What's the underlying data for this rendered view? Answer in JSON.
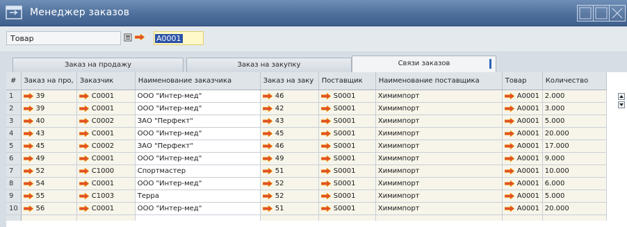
{
  "window": {
    "title": "Менеджер заказов"
  },
  "field": {
    "label": "Товар",
    "value": "A0001"
  },
  "tabs": [
    {
      "label": "Заказ на продажу"
    },
    {
      "label": "Заказ на закупку"
    },
    {
      "label": "Связи заказов"
    }
  ],
  "table": {
    "headers": [
      "#",
      "Заказ на про,",
      "Заказчик",
      "Наименование заказчика",
      "Заказ на заку",
      "Поставщик",
      "Наименование поставщика",
      "Товар",
      "Количество"
    ],
    "rows": [
      {
        "n": "1",
        "sale": "39",
        "cust": "C0001",
        "custName": "ООО \"Интер-мед\"",
        "purch": "46",
        "supp": "S0001",
        "suppName": "Химимпорт",
        "item": "A0001",
        "qty": "2.000"
      },
      {
        "n": "2",
        "sale": "39",
        "cust": "C0001",
        "custName": "ООО \"Интер-мед\"",
        "purch": "42",
        "supp": "S0001",
        "suppName": "Химимпорт",
        "item": "A0001",
        "qty": "3.000"
      },
      {
        "n": "3",
        "sale": "40",
        "cust": "C0002",
        "custName": "ЗАО \"Перфект\"",
        "purch": "43",
        "supp": "S0001",
        "suppName": "Химимпорт",
        "item": "A0001",
        "qty": "5.000"
      },
      {
        "n": "4",
        "sale": "43",
        "cust": "C0001",
        "custName": "ООО \"Интер-мед\"",
        "purch": "45",
        "supp": "S0001",
        "suppName": "Химимпорт",
        "item": "A0001",
        "qty": "20.000"
      },
      {
        "n": "5",
        "sale": "45",
        "cust": "C0002",
        "custName": "ЗАО \"Перфект\"",
        "purch": "46",
        "supp": "S0001",
        "suppName": "Химимпорт",
        "item": "A0001",
        "qty": "17.000"
      },
      {
        "n": "6",
        "sale": "49",
        "cust": "C0001",
        "custName": "ООО \"Интер-мед\"",
        "purch": "49",
        "supp": "S0001",
        "suppName": "Химимпорт",
        "item": "A0001",
        "qty": "9.000"
      },
      {
        "n": "7",
        "sale": "52",
        "cust": "C1000",
        "custName": "Спортмастер",
        "purch": "51",
        "supp": "S0001",
        "suppName": "Химимпорт",
        "item": "A0001",
        "qty": "10.000"
      },
      {
        "n": "8",
        "sale": "54",
        "cust": "C0001",
        "custName": "ООО \"Интер-мед\"",
        "purch": "52",
        "supp": "S0001",
        "suppName": "Химимпорт",
        "item": "A0001",
        "qty": "6.000"
      },
      {
        "n": "9",
        "sale": "55",
        "cust": "C1003",
        "custName": "Терра",
        "purch": "52",
        "supp": "S0001",
        "suppName": "Химимпорт",
        "item": "A0001",
        "qty": "5.000"
      },
      {
        "n": "10",
        "sale": "56",
        "cust": "C0001",
        "custName": "ООО \"Интер-мед\"",
        "purch": "51",
        "supp": "S0001",
        "suppName": "Химимпорт",
        "item": "A0001",
        "qty": "20.000"
      }
    ]
  },
  "icons": {
    "app": "window-icon",
    "link": "arrow-right-icon",
    "f4": "value-help-icon"
  },
  "colors": {
    "titlebar": "#4e6f9b",
    "arrow": "#e2502a",
    "input_bg": "#fff8c8",
    "selection": "#2b52a6"
  }
}
